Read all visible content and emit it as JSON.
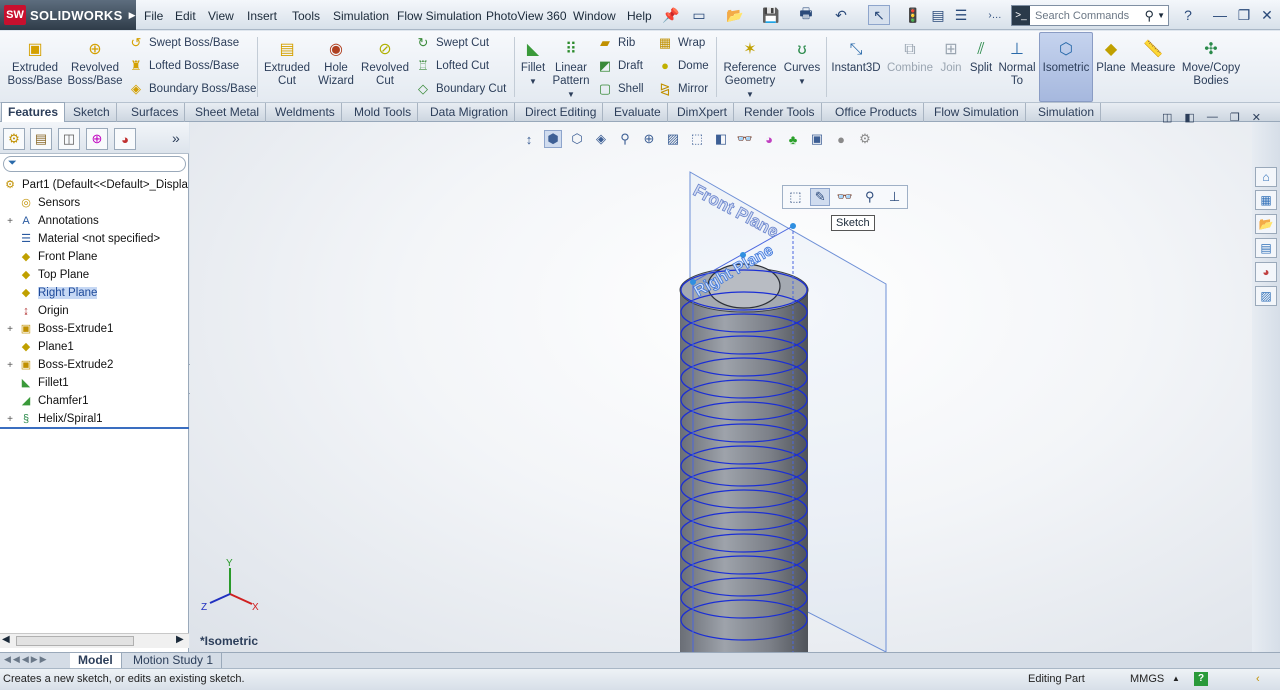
{
  "app": {
    "name": "SOLIDWORKS",
    "logo_text": "SW"
  },
  "menu": [
    "File",
    "Edit",
    "View",
    "Insert",
    "Tools",
    "Simulation",
    "Flow Simulation",
    "PhotoView 360",
    "Window",
    "Help"
  ],
  "search": {
    "placeholder": "Search Commands"
  },
  "command_manager": {
    "extruded_boss": "Extruded Boss/Base",
    "revolved_boss": "Revolved Boss/Base",
    "swept_boss": "Swept Boss/Base",
    "lofted_boss": "Lofted Boss/Base",
    "boundary_boss": "Boundary Boss/Base",
    "extruded_cut": "Extruded Cut",
    "hole_wizard": "Hole Wizard",
    "revolved_cut": "Revolved Cut",
    "swept_cut": "Swept Cut",
    "lofted_cut": "Lofted Cut",
    "boundary_cut": "Boundary Cut",
    "fillet": "Fillet",
    "linear_pattern": "Linear Pattern",
    "rib": "Rib",
    "draft": "Draft",
    "shell": "Shell",
    "wrap": "Wrap",
    "dome": "Dome",
    "mirror": "Mirror",
    "reference_geometry": "Reference Geometry",
    "curves": "Curves",
    "instant3d": "Instant3D",
    "combine": "Combine",
    "join": "Join",
    "split": "Split",
    "normal_to": "Normal To",
    "isometric": "Isometric",
    "plane": "Plane",
    "measure": "Measure",
    "move_copy": "Move/Copy Bodies"
  },
  "tabs": [
    "Features",
    "Sketch",
    "Surfaces",
    "Sheet Metal",
    "Weldments",
    "Mold Tools",
    "Data Migration",
    "Direct Editing",
    "Evaluate",
    "DimXpert",
    "Render Tools",
    "Office Products",
    "Flow Simulation",
    "Simulation"
  ],
  "active_tab": "Features",
  "tree": {
    "root": "Part1  (Default<<Default>_Displa",
    "items": [
      {
        "label": "Sensors",
        "icon": "sensor-icon",
        "expandable": false
      },
      {
        "label": "Annotations",
        "icon": "annotation-icon",
        "expandable": true
      },
      {
        "label": "Material <not specified>",
        "icon": "material-icon",
        "expandable": false
      },
      {
        "label": "Front Plane",
        "icon": "plane-icon",
        "expandable": false
      },
      {
        "label": "Top Plane",
        "icon": "plane-icon",
        "expandable": false
      },
      {
        "label": "Right Plane",
        "icon": "plane-icon",
        "expandable": false,
        "selected": true
      },
      {
        "label": "Origin",
        "icon": "origin-icon",
        "expandable": false
      },
      {
        "label": "Boss-Extrude1",
        "icon": "extrude-icon",
        "expandable": true
      },
      {
        "label": "Plane1",
        "icon": "plane-icon",
        "expandable": false
      },
      {
        "label": "Boss-Extrude2",
        "icon": "extrude-icon",
        "expandable": true
      },
      {
        "label": "Fillet1",
        "icon": "fillet-icon",
        "expandable": false
      },
      {
        "label": "Chamfer1",
        "icon": "chamfer-icon",
        "expandable": false
      },
      {
        "label": "Helix/Spiral1",
        "icon": "helix-icon",
        "expandable": true
      }
    ]
  },
  "viewport": {
    "view_name": "*Isometric",
    "front_plane_label": "Front Plane",
    "right_plane_label": "Right Plane",
    "tooltip": "Sketch",
    "triad": {
      "x": "X",
      "y": "Y",
      "z": "Z"
    }
  },
  "model_tabs": [
    "Model",
    "Motion Study 1"
  ],
  "status": {
    "message": "Creates a new sketch, or edits an existing sketch.",
    "mode": "Editing Part",
    "units": "MMGS"
  }
}
